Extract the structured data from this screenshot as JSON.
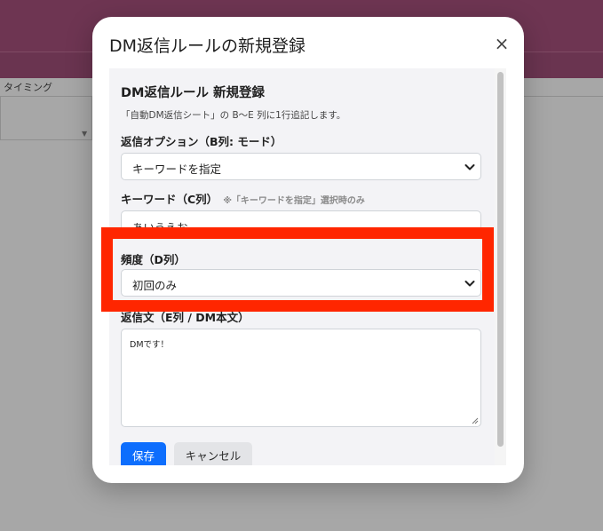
{
  "background": {
    "column_header": "タイミング"
  },
  "modal": {
    "title": "DM返信ルールの新規登録",
    "close_glyph": "×"
  },
  "form": {
    "heading": "DM返信ルール 新規登録",
    "description": "「自動DM返信シート」の B〜E 列に1行追記します。",
    "reply_option": {
      "label": "返信オプション（B列: モード）",
      "value": "キーワードを指定"
    },
    "keyword": {
      "label": "キーワード（C列）",
      "note": "※「キーワードを指定」選択時のみ",
      "value": "あいうえお"
    },
    "frequency": {
      "label": "頻度（D列）",
      "value": "初回のみ"
    },
    "reply_text": {
      "label": "返信文（E列 / DM本文）",
      "value": "DMです！"
    },
    "save_label": "保存",
    "cancel_label": "キャンセル"
  },
  "colors": {
    "primary": "#0d6efd",
    "highlight": "#ff2600",
    "app_bar": "#6e3552"
  }
}
